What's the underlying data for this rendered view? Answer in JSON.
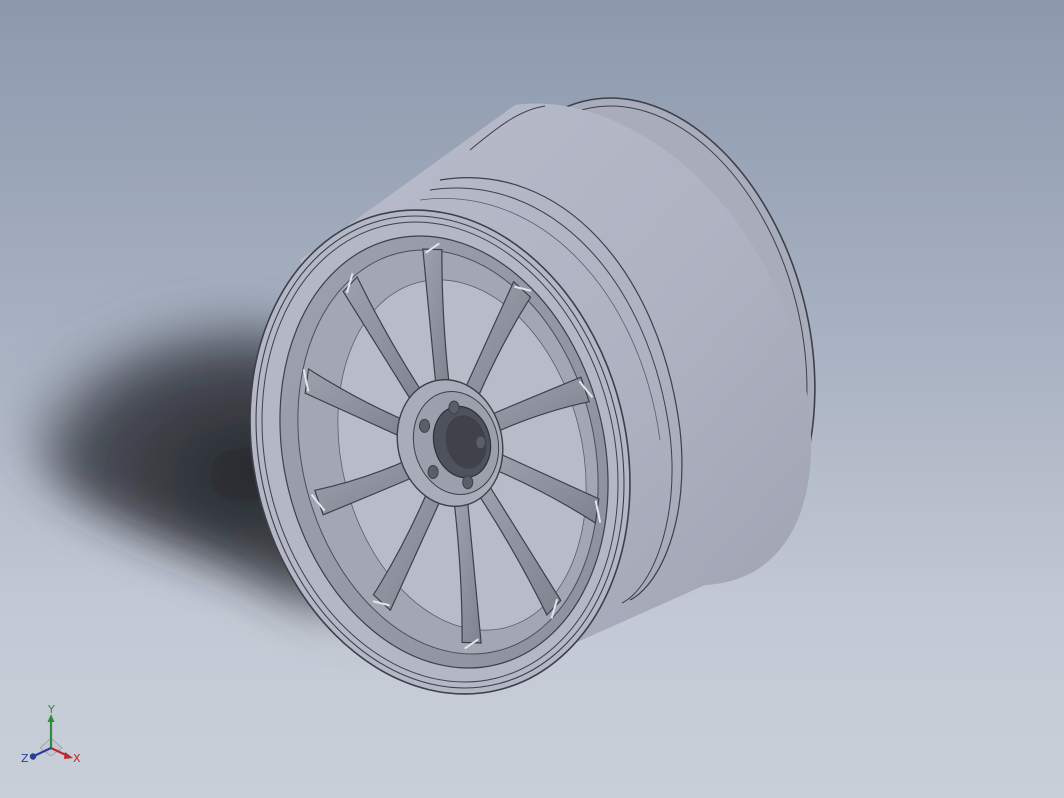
{
  "viewport": {
    "background_top": "#8c99ad",
    "background_bottom": "#c9cfd8"
  },
  "model": {
    "spoke_count": 10,
    "lug_hole_count": 5,
    "body_color": "#aeb3c2",
    "edge_color": "#3d4049",
    "shadow_color": "#1c1d22"
  },
  "triad": {
    "x_label": "X",
    "y_label": "Y",
    "z_label": "Z",
    "x_color": "#c0262b",
    "y_color": "#2f8c3a",
    "z_color": "#2a3f9c"
  }
}
